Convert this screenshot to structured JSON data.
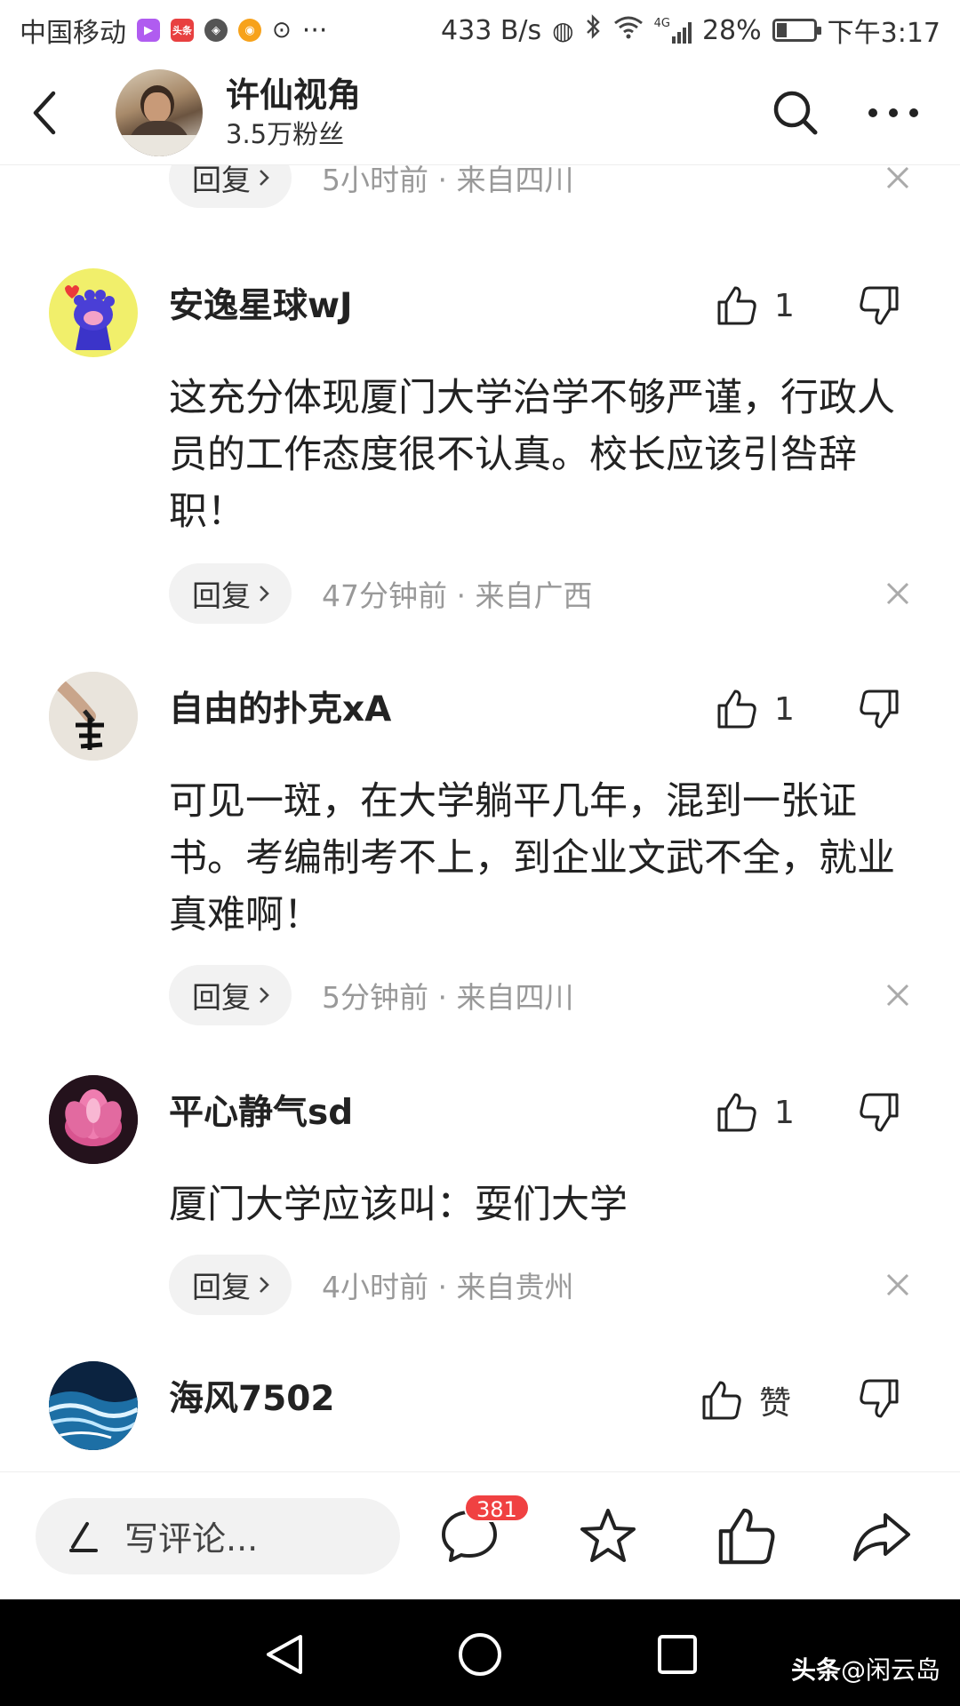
{
  "status_bar": {
    "carrier": "中国移动",
    "net_speed": "433 B/s",
    "network_type": "4G",
    "battery": "28%",
    "battery_level": 0.28,
    "time": "下午3:17",
    "app_badge": "头条",
    "more": "···"
  },
  "header": {
    "author_name": "许仙视角",
    "author_fans": "3.5万粉丝"
  },
  "previous_item": {
    "reply_label": "回复",
    "meta": "5小时前 · 来自四川"
  },
  "comments": [
    {
      "name": "安逸星球wJ",
      "like_label": "1",
      "text": "这充分体现厦门大学治学不够严谨，行政人员的工作态度很不认真。校长应该引咎辞职！",
      "reply_label": "回复",
      "meta": "47分钟前 · 来自广西"
    },
    {
      "name": "自由的扑克xA",
      "like_label": "1",
      "text": "可见一斑，在大学躺平几年，混到一张证书。考编制考不上，到企业文武不全，就业真难啊！",
      "reply_label": "回复",
      "meta": "5分钟前 · 来自四川"
    },
    {
      "name": "平心静气sd",
      "like_label": "1",
      "text": "厦门大学应该叫：耍们大学",
      "reply_label": "回复",
      "meta": "4小时前 · 来自贵州"
    },
    {
      "name": "海风7502",
      "like_label": "赞",
      "text": ""
    }
  ],
  "bottom_bar": {
    "write_placeholder": "写评论...",
    "comment_count": "381"
  },
  "watermark": {
    "brand": "头条",
    "handle": "@闲云岛"
  }
}
